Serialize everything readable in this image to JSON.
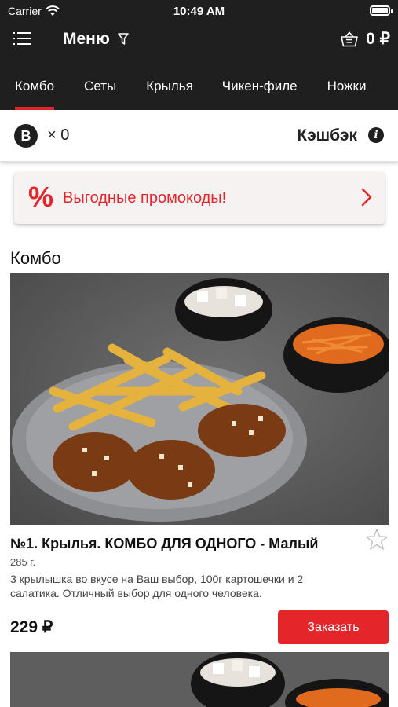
{
  "status_bar": {
    "carrier": "Carrier",
    "time": "10:49 AM"
  },
  "header": {
    "title": "Меню",
    "cart_total": "0 ₽"
  },
  "tabs": [
    {
      "label": "Комбо",
      "active": true
    },
    {
      "label": "Сеты",
      "active": false
    },
    {
      "label": "Крылья",
      "active": false
    },
    {
      "label": "Чикен-филе",
      "active": false
    },
    {
      "label": "Ножки",
      "active": false
    }
  ],
  "bonus": {
    "badge": "B",
    "count": "× 0",
    "cashback_label": "Кэшбэк",
    "info_glyph": "i"
  },
  "promo": {
    "icon": "%",
    "label": "Выгодные промокоды!"
  },
  "section": {
    "title": "Комбо"
  },
  "products": [
    {
      "name": "№1. Крылья. КОМБО ДЛЯ ОДНОГО - Малый",
      "weight": "285 г.",
      "description": "3 крылышка во вкусе на Ваш выбор, 100г картошечки и 2 салатика. Отличный выбор для одного человека.",
      "price": "229 ₽",
      "order_label": "Заказать"
    }
  ],
  "colors": {
    "accent": "#e4262b",
    "header_bg": "#1f1f1f",
    "promo_bg": "#f6f2f2"
  },
  "icons": [
    "wifi-icon",
    "battery-icon",
    "menu-list-icon",
    "filter-icon",
    "basket-icon",
    "info-icon",
    "chevron-right-icon",
    "star-icon"
  ]
}
